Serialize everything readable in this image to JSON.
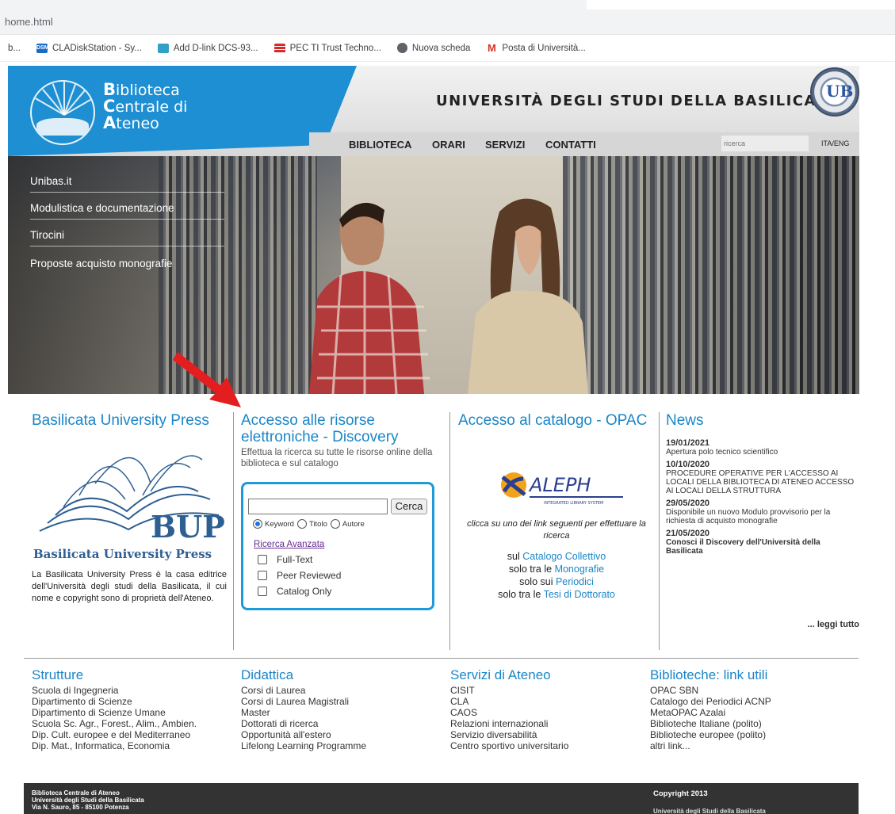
{
  "browser": {
    "url": "home.html",
    "bookmarks": [
      {
        "label": "b...",
        "icon": "generic-icon"
      },
      {
        "label": "CLADiskStation - Sy...",
        "icon": "dsm-icon"
      },
      {
        "label": "Add D-link DCS-93...",
        "icon": "dlink-icon"
      },
      {
        "label": "PEC TI Trust Techno...",
        "icon": "pec-icon"
      },
      {
        "label": "Nuova scheda",
        "icon": "globe-icon"
      },
      {
        "label": "Posta di Università...",
        "icon": "gmail-icon"
      }
    ]
  },
  "header": {
    "logo_line1": "Biblioteca",
    "logo_line2": "Centrale di",
    "logo_line3": "Ateneo",
    "university": "UNIVERSITÀ DEGLI STUDI DELLA BASILICATA",
    "nav": [
      "BIBLIOTECA",
      "ORARI",
      "SERVIZI",
      "CONTATTI"
    ],
    "search_placeholder": "ricerca",
    "lang": "ITA/ENG"
  },
  "side_menu": [
    "Unibas.it",
    "Modulistica e documentazione",
    "Tirocini",
    "Proposte acquisto monografie"
  ],
  "bup": {
    "title": "Basilicata University Press",
    "logo_text": "BUP",
    "logo_subtext": "Basilicata University Press",
    "description": "La Basilicata University Press è la casa editrice dell'Università degli studi della Basilicata, il cui nome e copyright sono di proprietà dell'Ateneo."
  },
  "discovery": {
    "title": "Accesso alle risorse elettroniche - Discovery",
    "subtitle": "Effettua la ricerca su tutte le risorse online della biblioteca e sul catalogo",
    "search_button": "Cerca",
    "radios": [
      "Keyword",
      "Titolo",
      "Autore"
    ],
    "advanced": "Ricerca Avanzata",
    "checks": [
      "Full-Text",
      "Peer Reviewed",
      "Catalog Only"
    ]
  },
  "opac": {
    "title": "Accesso al catalogo - OPAC",
    "aleph": "ALEPH",
    "aleph_sub": "INTEGRATED LIBRARY SYSTEM",
    "instructions": "clicca su uno dei link seguenti per effettuare la ricerca",
    "l1_pre": "sul",
    "l1_link": "Catalogo Collettivo",
    "l2_pre": "solo tra le",
    "l2_link": "Monografie",
    "l3_pre": "solo sui",
    "l3_link": "Periodici",
    "l4_pre": "solo tra le",
    "l4_link": "Tesi di Dottorato"
  },
  "news": {
    "title": "News",
    "items": [
      {
        "date": "19/01/2021",
        "text": "Apertura polo tecnico scientifico"
      },
      {
        "date": "10/10/2020",
        "text": "PROCEDURE OPERATIVE PER L'ACCESSO AI LOCALI DELLA BIBLIOTECA DI ATENEO ACCESSO AI LOCALI DELLA STRUTTURA"
      },
      {
        "date": "29/05/2020",
        "text": "Disponibile un nuovo Modulo provvisorio per la richiesta di acquisto monografie"
      },
      {
        "date": "21/05/2020",
        "text": "Conosci il Discovery dell'Università della Basilicata"
      }
    ],
    "more": "... leggi tutto"
  },
  "strutture": {
    "title": "Strutture",
    "items": [
      "Scuola di Ingegneria",
      "Dipartimento di Scienze",
      "Dipartimento di Scienze Umane",
      "Scuola Sc. Agr., Forest., Alim., Ambien.",
      "Dip. Cult. europee e del Mediterraneo",
      "Dip. Mat., Informatica, Economia"
    ]
  },
  "didattica": {
    "title": "Didattica",
    "items": [
      "Corsi di Laurea",
      "Corsi di Laurea Magistrali",
      "Master",
      "Dottorati di ricerca",
      "Opportunità all'estero",
      "Lifelong Learning Programme"
    ]
  },
  "servizi": {
    "title": "Servizi di Ateneo",
    "items": [
      "CISIT",
      "CLA",
      "CAOS",
      "Relazioni internazionali",
      "Servizio diversabilità",
      "Centro sportivo universitario"
    ]
  },
  "biblio": {
    "title": "Biblioteche: link utili",
    "items": [
      "OPAC SBN",
      "Catalogo dei Periodici ACNP",
      "MetaOPAC Azalai",
      "Biblioteche Italiane (polito)",
      "Biblioteche europee (polito)",
      "altri link..."
    ]
  },
  "footer": {
    "line1": "Biblioteca Centrale di Ateneo",
    "line2": "Università degli Studi della Basilicata",
    "line3": "Via N. Sauro, 85 - 85100 Potenza",
    "copyright": "Copyright 2013",
    "copyright2": "Università degli Studi della Basilicata"
  },
  "colors": {
    "accent": "#1e8fd2",
    "link": "#1a86c8",
    "arrow": "#e41e1e",
    "footer": "#333333"
  }
}
